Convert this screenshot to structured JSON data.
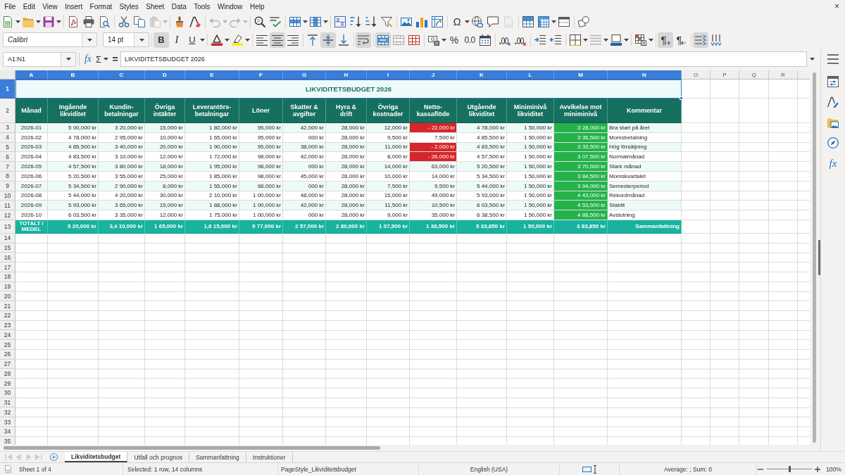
{
  "menu_bar": {
    "items": [
      "File",
      "Edit",
      "View",
      "Insert",
      "Format",
      "Styles",
      "Sheet",
      "Data",
      "Tools",
      "Window",
      "Help"
    ],
    "close": "×"
  },
  "standard_toolbar": {
    "paste_disabled": true,
    "undo_disabled": true,
    "redo_disabled": true,
    "headers_footers_disabled": true,
    "special_character": "Ω"
  },
  "format_toolbar": {
    "font_name": "Calibri",
    "font_size": "14 pt",
    "bold": {
      "label": "B",
      "on": true
    },
    "italic": {
      "label": "I",
      "on": false
    },
    "underline": {
      "label": "U",
      "on": false
    },
    "align_left": false,
    "align_center": true,
    "align_right": false,
    "align_top": false,
    "align_middle": true,
    "align_bottom": false,
    "wrap_text": true,
    "merge_and_center": true,
    "percent": "%",
    "number_format": "0.0",
    "paragraph_direction": [
      {
        "label": "¶",
        "selected": true
      },
      {
        "label": "¶",
        "selected": false
      }
    ],
    "text_horizontal": true,
    "text_vertical": false
  },
  "formula_bar": {
    "name_box": "A1:N1",
    "function_wizard": "fx",
    "sum": "Σ",
    "formula": "=",
    "content": "LIKVIDITETSBUDGET 2026"
  },
  "sidebar": {
    "functions": "fx"
  },
  "sheet": {
    "columns": [
      {
        "label": "A",
        "selected": true
      },
      {
        "label": "B",
        "selected": true
      },
      {
        "label": "C",
        "selected": true
      },
      {
        "label": "D",
        "selected": true
      },
      {
        "label": "E",
        "selected": true
      },
      {
        "label": "F",
        "selected": true
      },
      {
        "label": "G",
        "selected": true
      },
      {
        "label": "H",
        "selected": true
      },
      {
        "label": "I",
        "selected": true
      },
      {
        "label": "J",
        "selected": true
      },
      {
        "label": "K",
        "selected": true
      },
      {
        "label": "L",
        "selected": true
      },
      {
        "label": "M",
        "selected": true
      },
      {
        "label": "N",
        "selected": true
      },
      {
        "label": "O",
        "selected": false
      },
      {
        "label": "P",
        "selected": false
      },
      {
        "label": "Q",
        "selected": false
      },
      {
        "label": "R",
        "selected": false
      }
    ],
    "row_numbers": [
      {
        "label": "1",
        "selected": true
      },
      {
        "label": "2",
        "selected": false
      },
      {
        "label": "3",
        "selected": false
      },
      {
        "label": "4",
        "selected": false
      },
      {
        "label": "5",
        "selected": false
      },
      {
        "label": "6",
        "selected": false
      },
      {
        "label": "7",
        "selected": false
      },
      {
        "label": "8",
        "selected": false
      },
      {
        "label": "9",
        "selected": false
      },
      {
        "label": "10",
        "selected": false
      },
      {
        "label": "11",
        "selected": false
      },
      {
        "label": "12",
        "selected": false
      },
      {
        "label": "13",
        "selected": false
      },
      {
        "label": "14",
        "selected": false
      },
      {
        "label": "15",
        "selected": false
      },
      {
        "label": "16",
        "selected": false
      },
      {
        "label": "17",
        "selected": false
      },
      {
        "label": "18",
        "selected": false
      },
      {
        "label": "19",
        "selected": false
      },
      {
        "label": "20",
        "selected": false
      },
      {
        "label": "21",
        "selected": false
      },
      {
        "label": "22",
        "selected": false
      },
      {
        "label": "23",
        "selected": false
      },
      {
        "label": "24",
        "selected": false
      },
      {
        "label": "25",
        "selected": false
      },
      {
        "label": "26",
        "selected": false
      },
      {
        "label": "27",
        "selected": false
      },
      {
        "label": "28",
        "selected": false
      },
      {
        "label": "29",
        "selected": false
      },
      {
        "label": "30",
        "selected": false
      },
      {
        "label": "31",
        "selected": false
      },
      {
        "label": "32",
        "selected": false
      },
      {
        "label": "33",
        "selected": false
      },
      {
        "label": "34",
        "selected": false
      },
      {
        "label": "35",
        "selected": false
      }
    ],
    "title": {
      "text": "LIKVIDITETSBUDGET 2026",
      "selected": true
    },
    "headers": [
      "Månad",
      "Ingående likviditet",
      "Kundin-betalningar",
      "Övriga intäkter",
      "Leverantörs-betalningar",
      "Löner",
      "Skatter & avgifter",
      "Hyra & drift",
      "Övriga kostnader",
      "Netto-kassaflöde",
      "Utgående likviditet",
      "Miniminivå likviditet",
      "Avvikelse mot miniminivå",
      "Kommentar"
    ],
    "rows": [
      {
        "cells": [
          "2026-01",
          "5 00,000 kr",
          "3 20,000 kr",
          "15,000 kr",
          "1 80,000 kr",
          "95,000 kr",
          "42,000 kr",
          "28,000 kr",
          "12,000 kr",
          "- 22,000 kr",
          "4 78,000 kr",
          "1 50,000 kr",
          "3 28,000 kr",
          "Bra start på året"
        ],
        "net_negative": true,
        "above_minimum": true
      },
      {
        "cells": [
          "2026-02",
          "4 78,000 kr",
          "2 95,000 kr",
          "10,000 kr",
          "1 65,000 kr",
          "95,000 kr",
          "000 kr",
          "28,000 kr",
          "9,500 kr",
          "7,500 kr",
          "4 85,500 kr",
          "1 50,000 kr",
          "3 35,500 kr",
          "Momsbetalning"
        ],
        "net_negative": false,
        "above_minimum": true
      },
      {
        "cells": [
          "2026-03",
          "4 85,500 kr",
          "3 40,000 kr",
          "20,000 kr",
          "1 90,000 kr",
          "95,000 kr",
          "38,000 kr",
          "28,000 kr",
          "11,000 kr",
          "- 2,000 kr",
          "4 83,500 kr",
          "1 50,000 kr",
          "3 33,500 kr",
          "Hög försäljning"
        ],
        "net_negative": true,
        "above_minimum": true
      },
      {
        "cells": [
          "2026-04",
          "4 83,500 kr",
          "3 10,000 kr",
          "12,000 kr",
          "1 72,000 kr",
          "98,000 kr",
          "42,000 kr",
          "28,000 kr",
          "8,000 kr",
          "- 26,000 kr",
          "4 57,500 kr",
          "1 50,000 kr",
          "3 07,500 kr",
          "Normalmånad"
        ],
        "net_negative": true,
        "above_minimum": true
      },
      {
        "cells": [
          "2026-05",
          "4 57,500 kr",
          "3 80,000 kr",
          "18,000 kr",
          "1 95,000 kr",
          "98,000 kr",
          "000 kr",
          "28,000 kr",
          "14,000 kr",
          "63,000 kr",
          "5 20,500 kr",
          "1 50,000 kr",
          "3 70,500 kr",
          "Stark månad"
        ],
        "net_negative": false,
        "above_minimum": true
      },
      {
        "cells": [
          "2026-06",
          "5 20,500 kr",
          "3 55,000 kr",
          "25,000 kr",
          "1 85,000 kr",
          "98,000 kr",
          "45,000 kr",
          "28,000 kr",
          "10,000 kr",
          "14,000 kr",
          "5 34,500 kr",
          "1 50,000 kr",
          "3 84,500 kr",
          "Momskvartalet"
        ],
        "net_negative": false,
        "above_minimum": true
      },
      {
        "cells": [
          "2026-07",
          "5 34,500 kr",
          "2 90,000 kr",
          "8,000 kr",
          "1 55,000 kr",
          "98,000 kr",
          "000 kr",
          "28,000 kr",
          "7,500 kr",
          "9,500 kr",
          "5 44,000 kr",
          "1 50,000 kr",
          "3 94,000 kr",
          "Semesterperiod"
        ],
        "net_negative": false,
        "above_minimum": true
      },
      {
        "cells": [
          "2026-08",
          "5 44,000 kr",
          "4 20,000 kr",
          "30,000 kr",
          "2 10,000 kr",
          "1 00,000 kr",
          "48,000 kr",
          "28,000 kr",
          "15,000 kr",
          "49,000 kr",
          "5 93,000 kr",
          "1 50,000 kr",
          "4 43,000 kr",
          "Rekordmånad"
        ],
        "net_negative": false,
        "above_minimum": true
      },
      {
        "cells": [
          "2026-09",
          "5 93,000 kr",
          "3 65,000 kr",
          "15,000 kr",
          "1 88,000 kr",
          "1 00,000 kr",
          "42,000 kr",
          "28,000 kr",
          "11,500 kr",
          "10,500 kr",
          "6 03,500 kr",
          "1 50,000 kr",
          "4 53,500 kr",
          "Stabilt"
        ],
        "net_negative": false,
        "above_minimum": true
      },
      {
        "cells": [
          "2026-10",
          "6 03,500 kr",
          "3 35,000 kr",
          "12,000 kr",
          "1 75,000 kr",
          "1 00,000 kr",
          "000 kr",
          "28,000 kr",
          "9,000 kr",
          "35,000 kr",
          "6 38,500 kr",
          "1 50,000 kr",
          "4 88,500 kr",
          "Avslutning"
        ],
        "net_negative": false,
        "above_minimum": true
      }
    ],
    "totals": [
      "TOTALT / MEDEL",
      "5 20,000 kr",
      "3,4 10,000 kr",
      "1 65,000 kr",
      "1,8 15,000 kr",
      "9 77,000 kr",
      "2 57,000 kr",
      "2 80,000 kr",
      "1 07,500 kr",
      "1 38,500 kr",
      "5 33,850 kr",
      "1 50,000 kr",
      "3 83,850 kr",
      "Sammanfattning"
    ]
  },
  "sheet_tab_bar": {
    "navigation_disabled": true,
    "tabs": [
      {
        "label": "Likviditetsbudget",
        "selected": true
      },
      {
        "label": "Utfall och prognos",
        "selected": false
      },
      {
        "label": "Sammanfattning",
        "selected": false
      },
      {
        "label": "Instruktioner",
        "selected": false
      }
    ]
  },
  "status_bar": {
    "sheet": "Sheet 1 of 4",
    "selection": "Selected: 1 row, 14 columns",
    "page_style": "PageStyle_Likviditetsbudget",
    "language": "English (USA)",
    "summary": "Average: ; Sum: 0",
    "zoom": {
      "level": 0.5,
      "reading": "100%"
    }
  }
}
